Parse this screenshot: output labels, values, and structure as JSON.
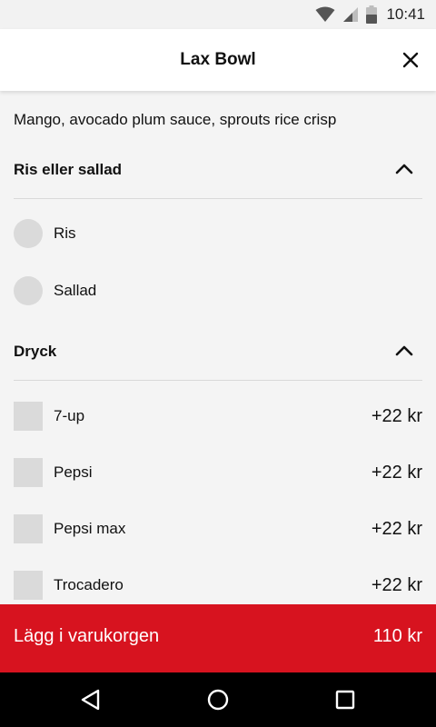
{
  "status_bar": {
    "time": "10:41",
    "icons": [
      "wifi-icon",
      "signal-icon",
      "battery-icon"
    ]
  },
  "header": {
    "title": "Lax Bowl",
    "close_icon": "close-icon"
  },
  "description": "Mango, avocado plum sauce, sprouts rice crisp",
  "sections": [
    {
      "title": "Ris eller sallad",
      "expanded": true,
      "type": "radio",
      "options": [
        {
          "label": "Ris",
          "selected": false
        },
        {
          "label": "Sallad",
          "selected": false
        }
      ]
    },
    {
      "title": "Dryck",
      "expanded": true,
      "type": "checkbox",
      "options": [
        {
          "label": "7-up",
          "price": "+22 kr",
          "checked": false
        },
        {
          "label": "Pepsi",
          "price": "+22 kr",
          "checked": false
        },
        {
          "label": "Pepsi max",
          "price": "+22 kr",
          "checked": false
        },
        {
          "label": "Trocadero",
          "price": "+22 kr",
          "checked": false
        }
      ]
    }
  ],
  "cart": {
    "label": "Lägg i varukorgen",
    "total": "110 kr",
    "color": "#d7131f"
  },
  "nav_bar": {
    "icons": [
      "back-icon",
      "home-icon",
      "recents-icon"
    ]
  }
}
